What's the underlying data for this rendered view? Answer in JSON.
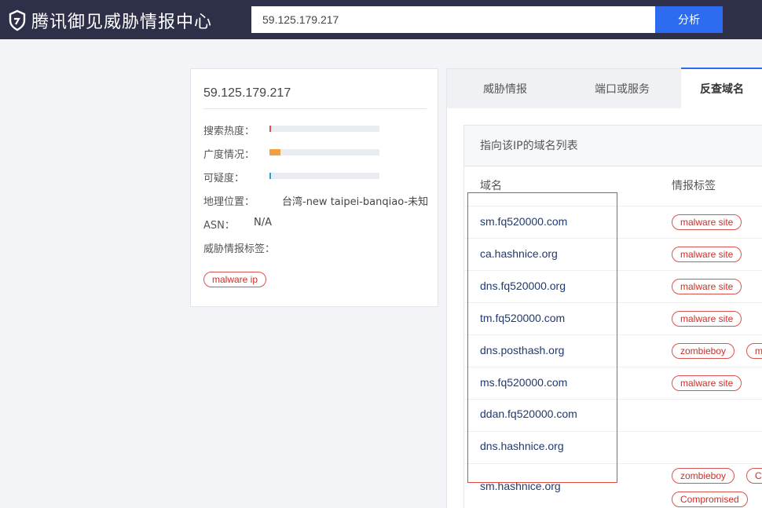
{
  "header": {
    "title": "腾讯御见威胁情报中心",
    "search_value": "59.125.179.217",
    "analyze_label": "分析"
  },
  "summary": {
    "ip": "59.125.179.217",
    "search_heat_label": "搜索热度：",
    "search_heat_level": 0.014,
    "spread_label": "广度情况：",
    "spread_level": 0.1,
    "suspicion_label": "可疑度：",
    "suspicion_level": 0.014,
    "geo_label": "地理位置：",
    "geo_value": "台湾-new taipei-banqiao-未知",
    "asn_label": "ASN：",
    "asn_value": "N/A",
    "threat_tags_label": "威胁情报标签：",
    "threat_tags": [
      "malware ip"
    ]
  },
  "tabs": [
    "威胁情报",
    "端口或服务",
    "反查域名"
  ],
  "active_tab": 2,
  "domain_list": {
    "title": "指向该IP的域名列表",
    "col_domain": "域名",
    "col_tags": "情报标签",
    "rows": [
      {
        "domain": "sm.fq520000.com",
        "tags": [
          "malware site"
        ]
      },
      {
        "domain": "ca.hashnice.org",
        "tags": [
          "malware site"
        ]
      },
      {
        "domain": "dns.fq520000.org",
        "tags": [
          "malware site"
        ]
      },
      {
        "domain": "tm.fq520000.com",
        "tags": [
          "malware site"
        ]
      },
      {
        "domain": "dns.posthash.org",
        "tags": [
          "zombieboy",
          "m"
        ]
      },
      {
        "domain": "ms.fq520000.com",
        "tags": [
          "malware site"
        ]
      },
      {
        "domain": "ddan.fq520000.com",
        "tags": []
      },
      {
        "domain": "dns.hashnice.org",
        "tags": []
      },
      {
        "domain": "sm.hashnice.org",
        "tags": [
          "zombieboy",
          "C",
          "Compromised"
        ]
      }
    ]
  },
  "colors": {
    "topbar": "#2e2f49",
    "accent": "#2d6cf0",
    "heat": "#e05050",
    "spread": "#f0a040",
    "suspicion": "#2a9fd8",
    "tag_border": "#d9534f",
    "highlight_box": "#e0463f"
  }
}
